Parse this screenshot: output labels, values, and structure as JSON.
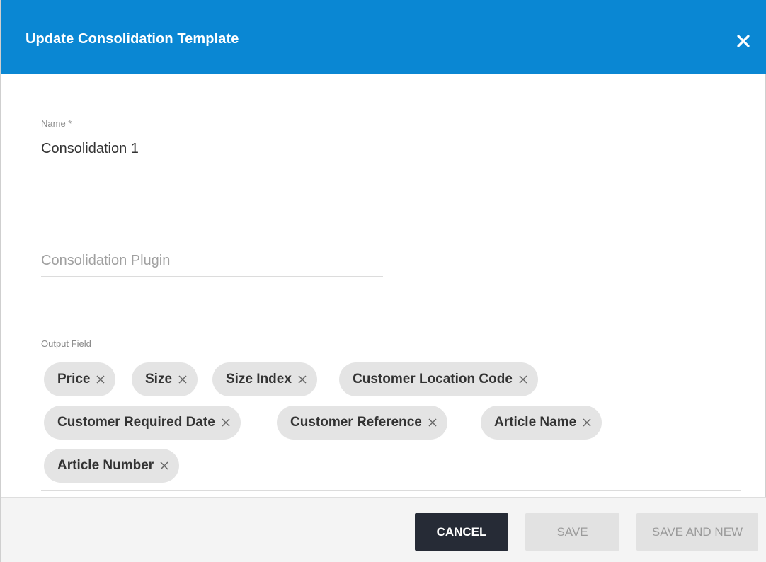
{
  "dialog": {
    "title": "Update Consolidation Template"
  },
  "name_field": {
    "label": "Name *",
    "value": "Consolidation 1"
  },
  "plugin_field": {
    "placeholder": "Consolidation Plugin"
  },
  "output_field": {
    "label": "Output Field",
    "chips": [
      "Price",
      "Size",
      "Size Index",
      "Customer Location Code",
      "Customer Required Date",
      "Customer Reference",
      "Article Name",
      "Article Number"
    ]
  },
  "footer": {
    "cancel_label": "CANCEL",
    "save_label": "SAVE",
    "save_and_new_label": "SAVE AND NEW"
  },
  "colors": {
    "header": "#0a87d3",
    "chip": "#e4e4e4",
    "cancel_button": "#262b36",
    "disabled_button": "#e2e2e2"
  },
  "icons": {
    "close": "close-icon",
    "remove_chip": "close-icon"
  }
}
